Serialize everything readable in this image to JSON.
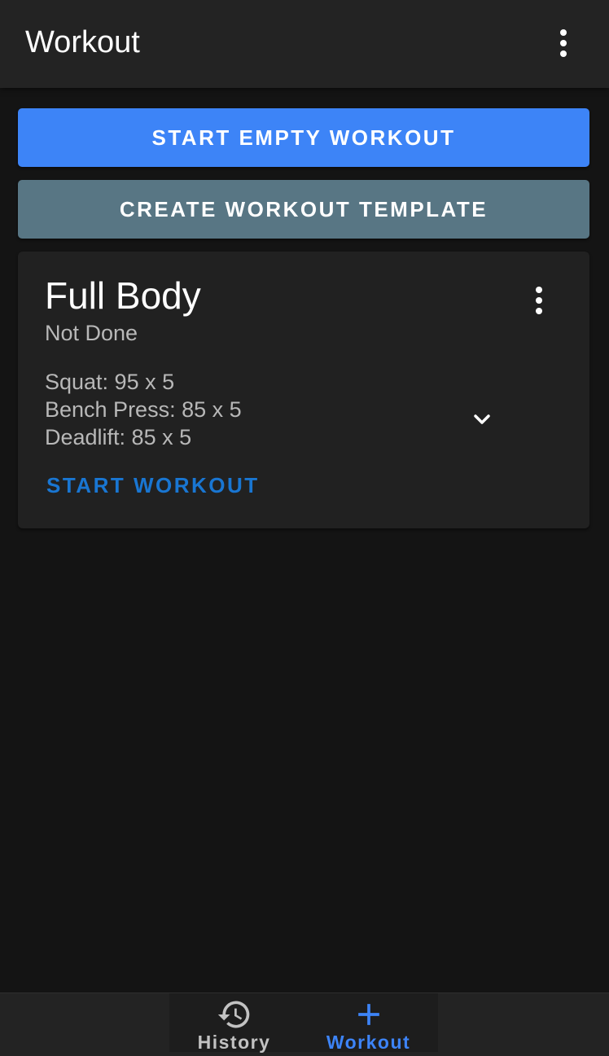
{
  "app_bar": {
    "title": "Workout",
    "overflow_icon": "more-vertical-icon"
  },
  "actions": {
    "start_empty_label": "START EMPTY WORKOUT",
    "create_template_label": "CREATE WORKOUT TEMPLATE"
  },
  "template_card": {
    "title": "Full Body",
    "status": "Not Done",
    "exercises": [
      "Squat: 95 x 5",
      "Bench Press: 85 x 5",
      "Deadlift: 85 x 5"
    ],
    "expand_icon": "chevron-down-icon",
    "overflow_icon": "more-vertical-icon",
    "start_label": "START WORKOUT"
  },
  "bottom_nav": {
    "items": [
      {
        "label": "History",
        "icon": "history-icon",
        "active": false
      },
      {
        "label": "Workout",
        "icon": "plus-icon",
        "active": true
      }
    ]
  },
  "colors": {
    "background": "#141414",
    "app_bar": "#232323",
    "primary": "#3d84f7",
    "secondary_button": "#587684",
    "card": "#212121",
    "link": "#1976d2",
    "text_secondary": "#b8b8b8"
  }
}
